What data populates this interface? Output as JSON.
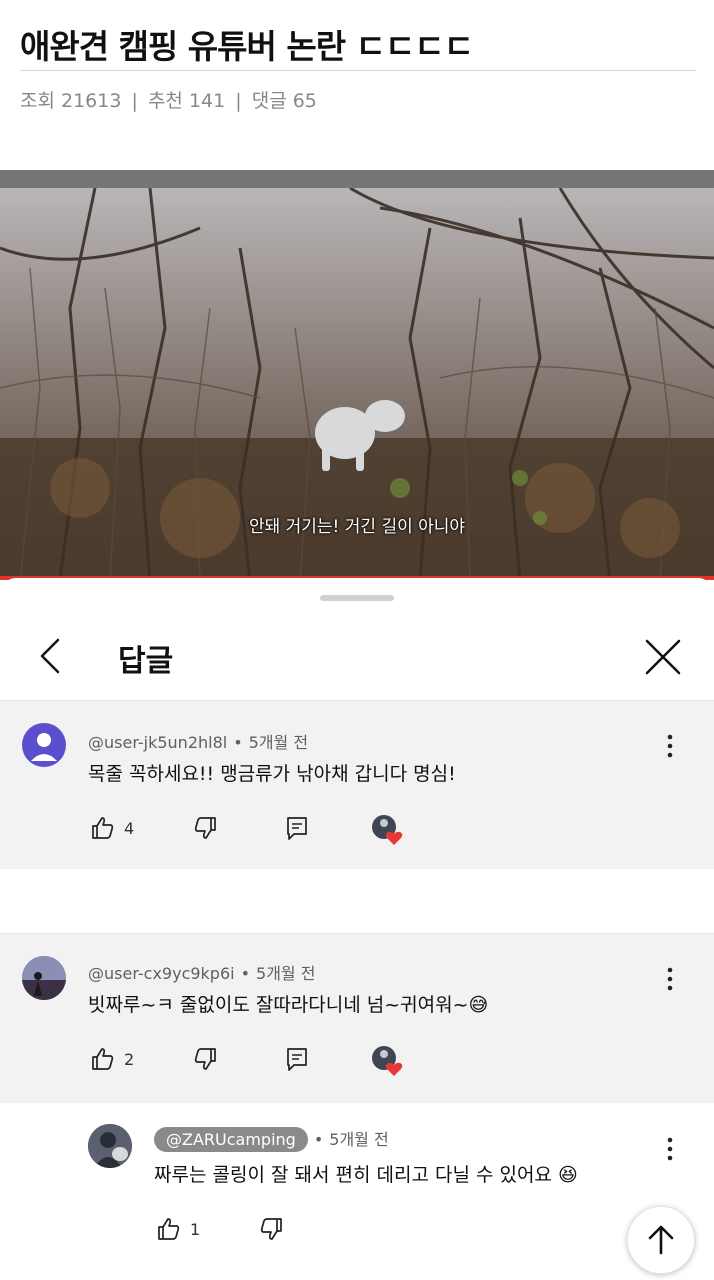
{
  "post": {
    "title": "애완견 캠핑 유튜버 논란 ㄷㄷㄷㄷ",
    "views": "조회 21613",
    "recommends": "추천 141",
    "comments": "댓글 65",
    "separator": "|"
  },
  "video": {
    "subtitle": "안돼 거기는! 거긴 길이 아니야"
  },
  "sheet": {
    "title": "답글"
  },
  "replies": [
    {
      "author": "@user-jk5un2hl8l",
      "time": "5개월 전",
      "text": "목줄 꼭하세요!!  맹금류가  낚아채 갑니다  명심!",
      "likes": "4",
      "avatar_color": "#5a4fcf",
      "hearted": true
    },
    {
      "author": "@user-cx9yc9kp6i",
      "time": "5개월 전",
      "text": "빗짜루~ㅋ 줄없이도 잘따라다니네 넘~귀여워~",
      "emoji": "😅",
      "likes": "2",
      "hearted": true
    },
    {
      "author": "@ZARUcamping",
      "time": "5개월 전",
      "text": "짜루는 콜링이 잘 돼서 편히 데리고 다닐 수 있어요",
      "emoji": "😆",
      "likes": "1",
      "is_owner": true
    }
  ],
  "colors": {
    "heart": "#e53935",
    "progress": "#e0332a"
  },
  "icons": [
    "chevron-left-icon",
    "close-icon",
    "more-vert-icon",
    "thumb-up-icon",
    "thumb-down-icon",
    "reply-icon",
    "arrow-up-icon"
  ]
}
